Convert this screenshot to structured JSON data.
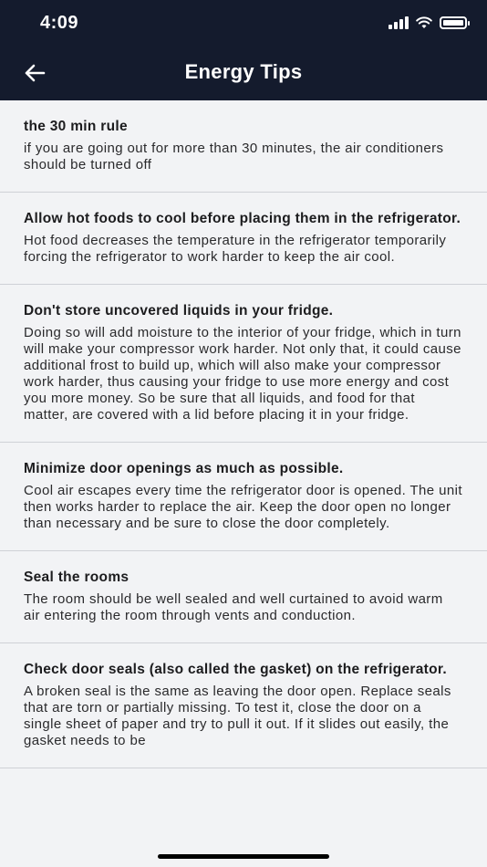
{
  "status": {
    "time": "4:09"
  },
  "header": {
    "title": "Energy Tips"
  },
  "tips": [
    {
      "title": "the 30 min rule",
      "body": "if you are going out for more than 30 minutes, the air conditioners should be turned off"
    },
    {
      "title": "Allow hot foods to cool before placing them in the refrigerator.",
      "body": "Hot food decreases the temperature in the refrigerator temporarily forcing the refrigerator to work harder to keep the air cool."
    },
    {
      "title": "Don't store uncovered liquids in your fridge.",
      "body": "Doing so will add moisture to the interior of your fridge, which in turn will make your compressor work harder. Not only that, it could cause additional frost to build up, which will also make your compressor work harder, thus causing your fridge to use more energy and cost you more money. So be sure that all liquids, and food for that matter, are covered with a lid before placing it in your fridge."
    },
    {
      "title": "Minimize door openings as much as possible.",
      "body": "Cool air escapes every time the refrigerator door is opened. The unit then works harder to replace the air. Keep the door open no longer than necessary and be sure to close the door completely."
    },
    {
      "title": "Seal the rooms",
      "body": "The room should be well sealed and well curtained to avoid warm air entering the room through vents and conduction."
    },
    {
      "title": "Check door seals (also called the gasket) on the refrigerator.",
      "body": "A broken seal is the same as leaving the door open. Replace seals that are torn or partially missing. To test it, close the door on a single sheet of paper and try to pull it out. If it slides out easily, the gasket needs to be"
    }
  ],
  "icons": {
    "back": "arrow-left-icon",
    "wifi": "wifi-icon",
    "signal": "cellular-signal-icon",
    "battery": "battery-icon"
  },
  "colors": {
    "header_bg": "#141b2d",
    "page_bg": "#f2f3f5",
    "divider": "#cfd1d6"
  }
}
